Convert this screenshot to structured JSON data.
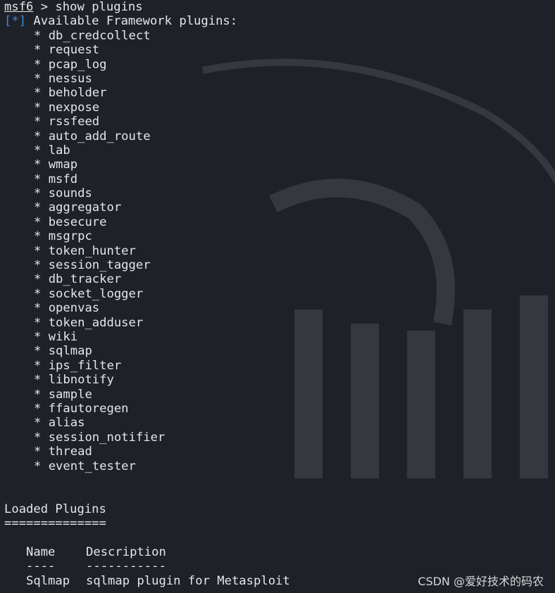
{
  "prompt": {
    "name": "msf6",
    "separator": " > ",
    "command": "show plugins"
  },
  "available": {
    "tag": "[*]",
    "heading": " Available Framework plugins:",
    "bullet": "* ",
    "plugins": [
      "db_credcollect",
      "request",
      "pcap_log",
      "nessus",
      "beholder",
      "nexpose",
      "rssfeed",
      "auto_add_route",
      "lab",
      "wmap",
      "msfd",
      "sounds",
      "aggregator",
      "besecure",
      "msgrpc",
      "token_hunter",
      "session_tagger",
      "db_tracker",
      "socket_logger",
      "openvas",
      "token_adduser",
      "wiki",
      "sqlmap",
      "ips_filter",
      "libnotify",
      "sample",
      "ffautoregen",
      "alias",
      "session_notifier",
      "thread",
      "event_tester"
    ]
  },
  "loaded": {
    "heading": "Loaded Plugins",
    "underline": "==============",
    "columns": {
      "name": "Name",
      "description": "Description",
      "name_rule": "----",
      "description_rule": "-----------"
    },
    "rows": [
      {
        "name": "Sqlmap",
        "description": "sqlmap plugin for Metasploit"
      }
    ]
  },
  "watermark": "CSDN @爱好技术的码农",
  "colors": {
    "background": "#1f2129",
    "text": "#e6e6e6",
    "info_tag": "#3a8ad8"
  }
}
